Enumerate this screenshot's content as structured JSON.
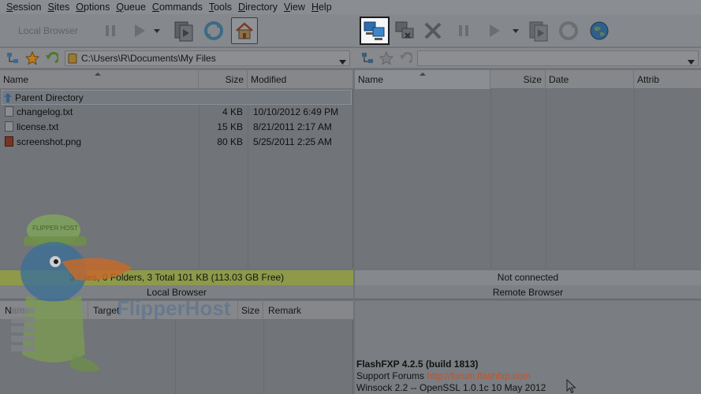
{
  "menu": [
    "Session",
    "Sites",
    "Options",
    "Queue",
    "Commands",
    "Tools",
    "Directory",
    "View",
    "Help"
  ],
  "local_toolbar": {
    "local_browser_label": "Local Browser"
  },
  "icons": {
    "pause": "pause-icon",
    "play": "play-icon",
    "dropdown": "chevron-down-icon",
    "transfer": "transfer-icon",
    "refresh": "refresh-icon",
    "home": "home-icon",
    "connect": "connect-icon",
    "disconnect": "disconnect-icon",
    "abort": "close-icon",
    "globe": "globe-icon",
    "tree": "folder-tree-icon",
    "star": "favorites-icon",
    "back": "back-icon"
  },
  "local": {
    "path": "C:\\Users\\R\\Documents\\My Files",
    "columns": {
      "name": "Name",
      "size": "Size",
      "modified": "Modified"
    },
    "parent_label": "Parent Directory",
    "files": [
      {
        "name": "changelog.txt",
        "size": "4 KB",
        "modified": "10/10/2012 6:49 PM"
      },
      {
        "name": "license.txt",
        "size": "15 KB",
        "modified": "8/21/2011 2:17 AM"
      },
      {
        "name": "screenshot.png",
        "size": "80 KB",
        "modified": "5/25/2011 2:25 AM"
      }
    ],
    "status": "3 Files, 0 Folders, 3 Total 101 KB (113.03 GB Free)",
    "panel_label": "Local Browser"
  },
  "remote": {
    "path": "",
    "columns": {
      "name": "Name",
      "size": "Size",
      "date": "Date",
      "attrib": "Attrib"
    },
    "status": "Not connected",
    "panel_label": "Remote Browser"
  },
  "queue": {
    "columns": {
      "name": "Name",
      "target": "Target",
      "size": "Size",
      "remark": "Remark"
    }
  },
  "log": {
    "title": "FlashFXP 4.2.5 (build 1813)",
    "forums_prefix": "Support Forums ",
    "forums_link": "http://forum.flashfxp.com",
    "winsock": "Winsock 2.2 -- OpenSSL 1.0.1c 10 May 2012"
  },
  "watermark": {
    "cap_text": "FLIPPER HOST",
    "brand": "FlipperHost"
  },
  "colors": {
    "local_status_bg": "#8e9a4a",
    "link": "#c0532a",
    "highlight": "#ffffff"
  }
}
